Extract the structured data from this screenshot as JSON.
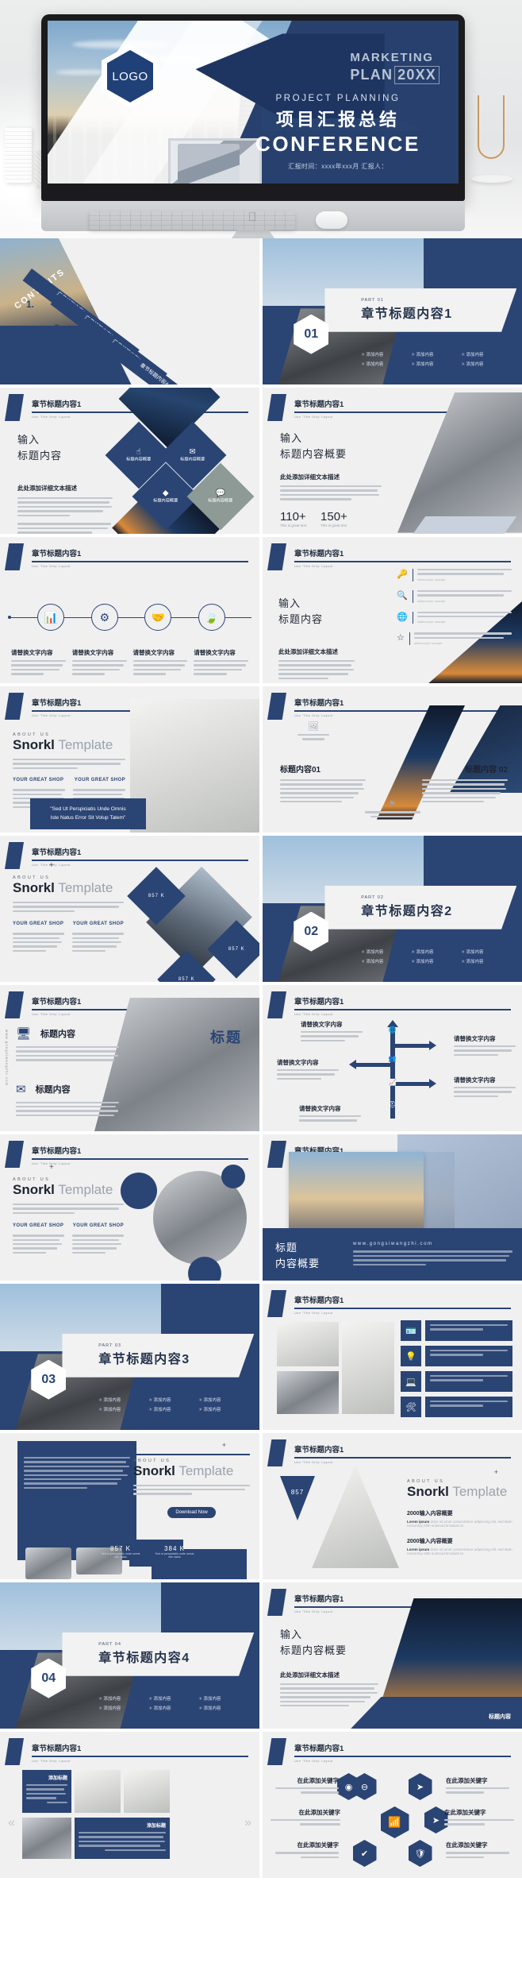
{
  "hero": {
    "logo": "LOGO",
    "marketing_line1": "MARKETING",
    "marketing_line2": "PLAN",
    "marketing_year": "20XX",
    "eyebrow": "PROJECT PLANNING",
    "title_cn": "项目汇报总结",
    "title_en": "CONFERENCE",
    "meta": "汇报时间：xxxx年xxx月  汇报人："
  },
  "common": {
    "slide_header": "章节标题内容1",
    "slide_subheader": "Use 'Title Only' Layout",
    "input_label": "输入",
    "title_content": "标题内容",
    "title_content_overview": "标题内容概要",
    "detail_desc": "此处添加详细文本描述",
    "add_content": "添加内容",
    "replace_text": "请替换文字内容",
    "about_us": "ABOUT US",
    "snorkl_bold": "Snorkl",
    "snorkl_light": "Template",
    "your_great_shop": "YOUR GREAT SHOP",
    "website": "www.gongsiwangzhi.com",
    "website_vertical": "www.gongsiwangzhi.com",
    "lorem": "Lorem ipsum dolor sit amet, consectetur adipiscing elit. Aliquam sit amet metus commodo, tempor nisl non.",
    "cn_filler": "详细文本描述xx此处添加详细文本描述，建议与标题相关并符合整体语言风格。语言描述尽量简洁生动明确，并言简意赅地以14字以内的数字短句分叶之凡。"
  },
  "contents_slide": {
    "label": "CONTENTS",
    "items": [
      {
        "num": "1.",
        "label": "章节标题内容1"
      },
      {
        "num": "2.",
        "label": "章节标题内容2"
      },
      {
        "num": "3.",
        "label": "章节标题内容3"
      },
      {
        "num": "4.",
        "label": "章节标题内容4"
      }
    ]
  },
  "parts": [
    {
      "part": "PART 01",
      "title": "章节标题内容1",
      "num": "01"
    },
    {
      "part": "PART 02",
      "title": "章节标题内容2",
      "num": "02"
    },
    {
      "part": "PART 03",
      "title": "章节标题内容3",
      "num": "03"
    },
    {
      "part": "PART 04",
      "title": "章节标题内容4",
      "num": "04"
    }
  ],
  "diamond_slide": {
    "items": [
      "标题内容概要",
      "标题内容概要",
      "标题内容概要",
      "标题内容概要"
    ]
  },
  "kpi_slide": {
    "kpi1": "110+",
    "kpi2": "150+",
    "kpi_sub1": "This is great text",
    "kpi_sub2": "This is great text"
  },
  "kpi_857": {
    "v1": "857 K",
    "v2": "384 K",
    "sub1": "Sed ut perspiciatis unde omnis iste natus",
    "sub2": "Sed ut perspiciatis unde omnis iste natus",
    "diamond1": "857 K",
    "diamond2": "857 K",
    "diamond3": "857 K",
    "triangle": "857"
  },
  "quote_slide": {
    "quote_line1": "\"Sed Ut Perspiciatis Unde Omnis",
    "quote_line2": "Iste Natus Error Sit Volup Tatem\""
  },
  "two_col_slide": {
    "left_title": "标题内容01",
    "right_title": "标题内容 02"
  },
  "overview_slide": {
    "title_line1": "标题",
    "title_line2": "内容概要"
  },
  "title_icon_slide": {
    "big_title": "标题",
    "row1": "标题内容",
    "row2": "标题内容"
  },
  "download_slide": {
    "button": "Download Now"
  },
  "content_2000": {
    "heading1": "2000输入内容概要",
    "heading2": "2000输入内容概要",
    "lorem_bold": "Lorem ipsum",
    "lorem_rest": "dolor sit amet consectetuer adipiscing elit, sed diam nonummy nibh euismod tincidunt ut"
  },
  "gallery_slide": {
    "title1": "添加标题",
    "title2": "添加标题",
    "body1": "点击添加相关文明描述文字，点击添加相关描述文字，点击添加相关描述文字，点击添加相关描述文字",
    "body2": "添加文字内容添加文字内容，添加文字内容添加文字内容添加文字内容，添加文字内容添加文字内容添加文字内容，添加文字内容添加文字内容"
  },
  "hex_slide": {
    "items": [
      {
        "title": "在此添加关键字",
        "body": "此部分内容操作为文字辅助占位显示（建议使用主题字体）。"
      },
      {
        "title": "在此添加关键字",
        "body": "此部分内容操作为文字辅助占位显示（建议使用主题字体）。"
      },
      {
        "title": "在此添加关键字",
        "body": "此部分内容操作为文字辅助占位显示（建议使用主题字体）。"
      },
      {
        "title": "在此添加关键字",
        "body": "此部分内容操作为文字辅助占位显示（建议使用主题字体）。"
      },
      {
        "title": "在此添加关键字",
        "body": "此部分内容操作为文字辅助占位显示（建议使用主题字体）。"
      },
      {
        "title": "在此添加关键字",
        "body": "此部分内容操作为文字辅助占位显示（建议使用主题字体）。"
      }
    ]
  },
  "colors": {
    "navy": "#2a4474",
    "navy_dark": "#1e3562",
    "slide_bg": "#f0f0f0",
    "page_bg": "#ffffff"
  }
}
